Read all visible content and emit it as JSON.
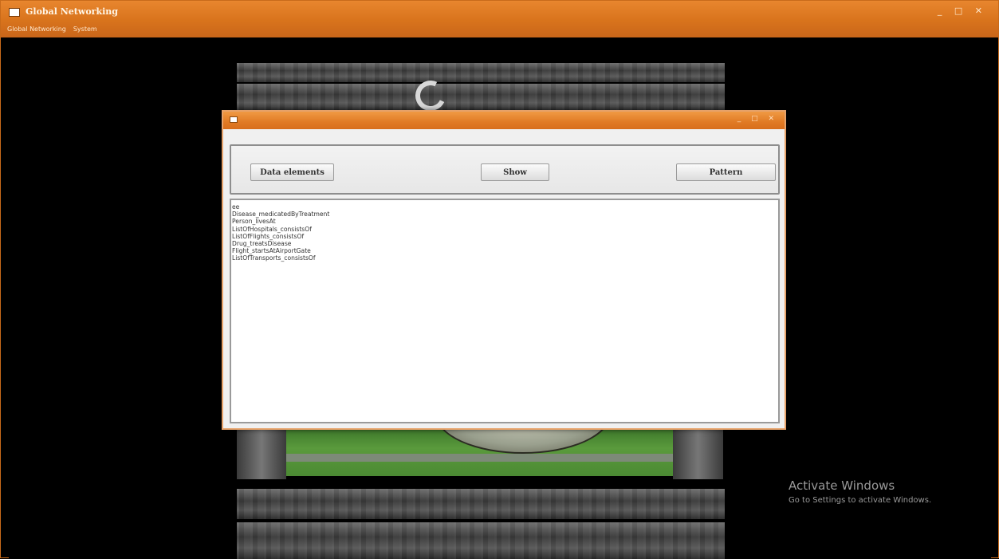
{
  "window": {
    "title": "Global Networking",
    "controls": "_ □ ✕",
    "menu": [
      "Global Networking",
      "System"
    ]
  },
  "dialog": {
    "controls": "_ □ ✕",
    "buttons": {
      "data_elements": "Data elements",
      "show": "Show",
      "pattern": "Pattern"
    },
    "list_items": [
      "ee",
      "Disease_medicatedByTreatment",
      "Person_livesAt",
      "ListOfHospitals_consistsOf",
      "ListOfFlights_consistsOf",
      "Drug_treatsDisease",
      "Flight_startsAtAirportGate",
      "ListOfTransports_consistsOf"
    ]
  },
  "watermark": {
    "title": "Activate Windows",
    "subtitle": "Go to Settings to activate Windows."
  },
  "colors": {
    "titlebar": "#d8731c",
    "dialog_border": "#e6a26a"
  }
}
